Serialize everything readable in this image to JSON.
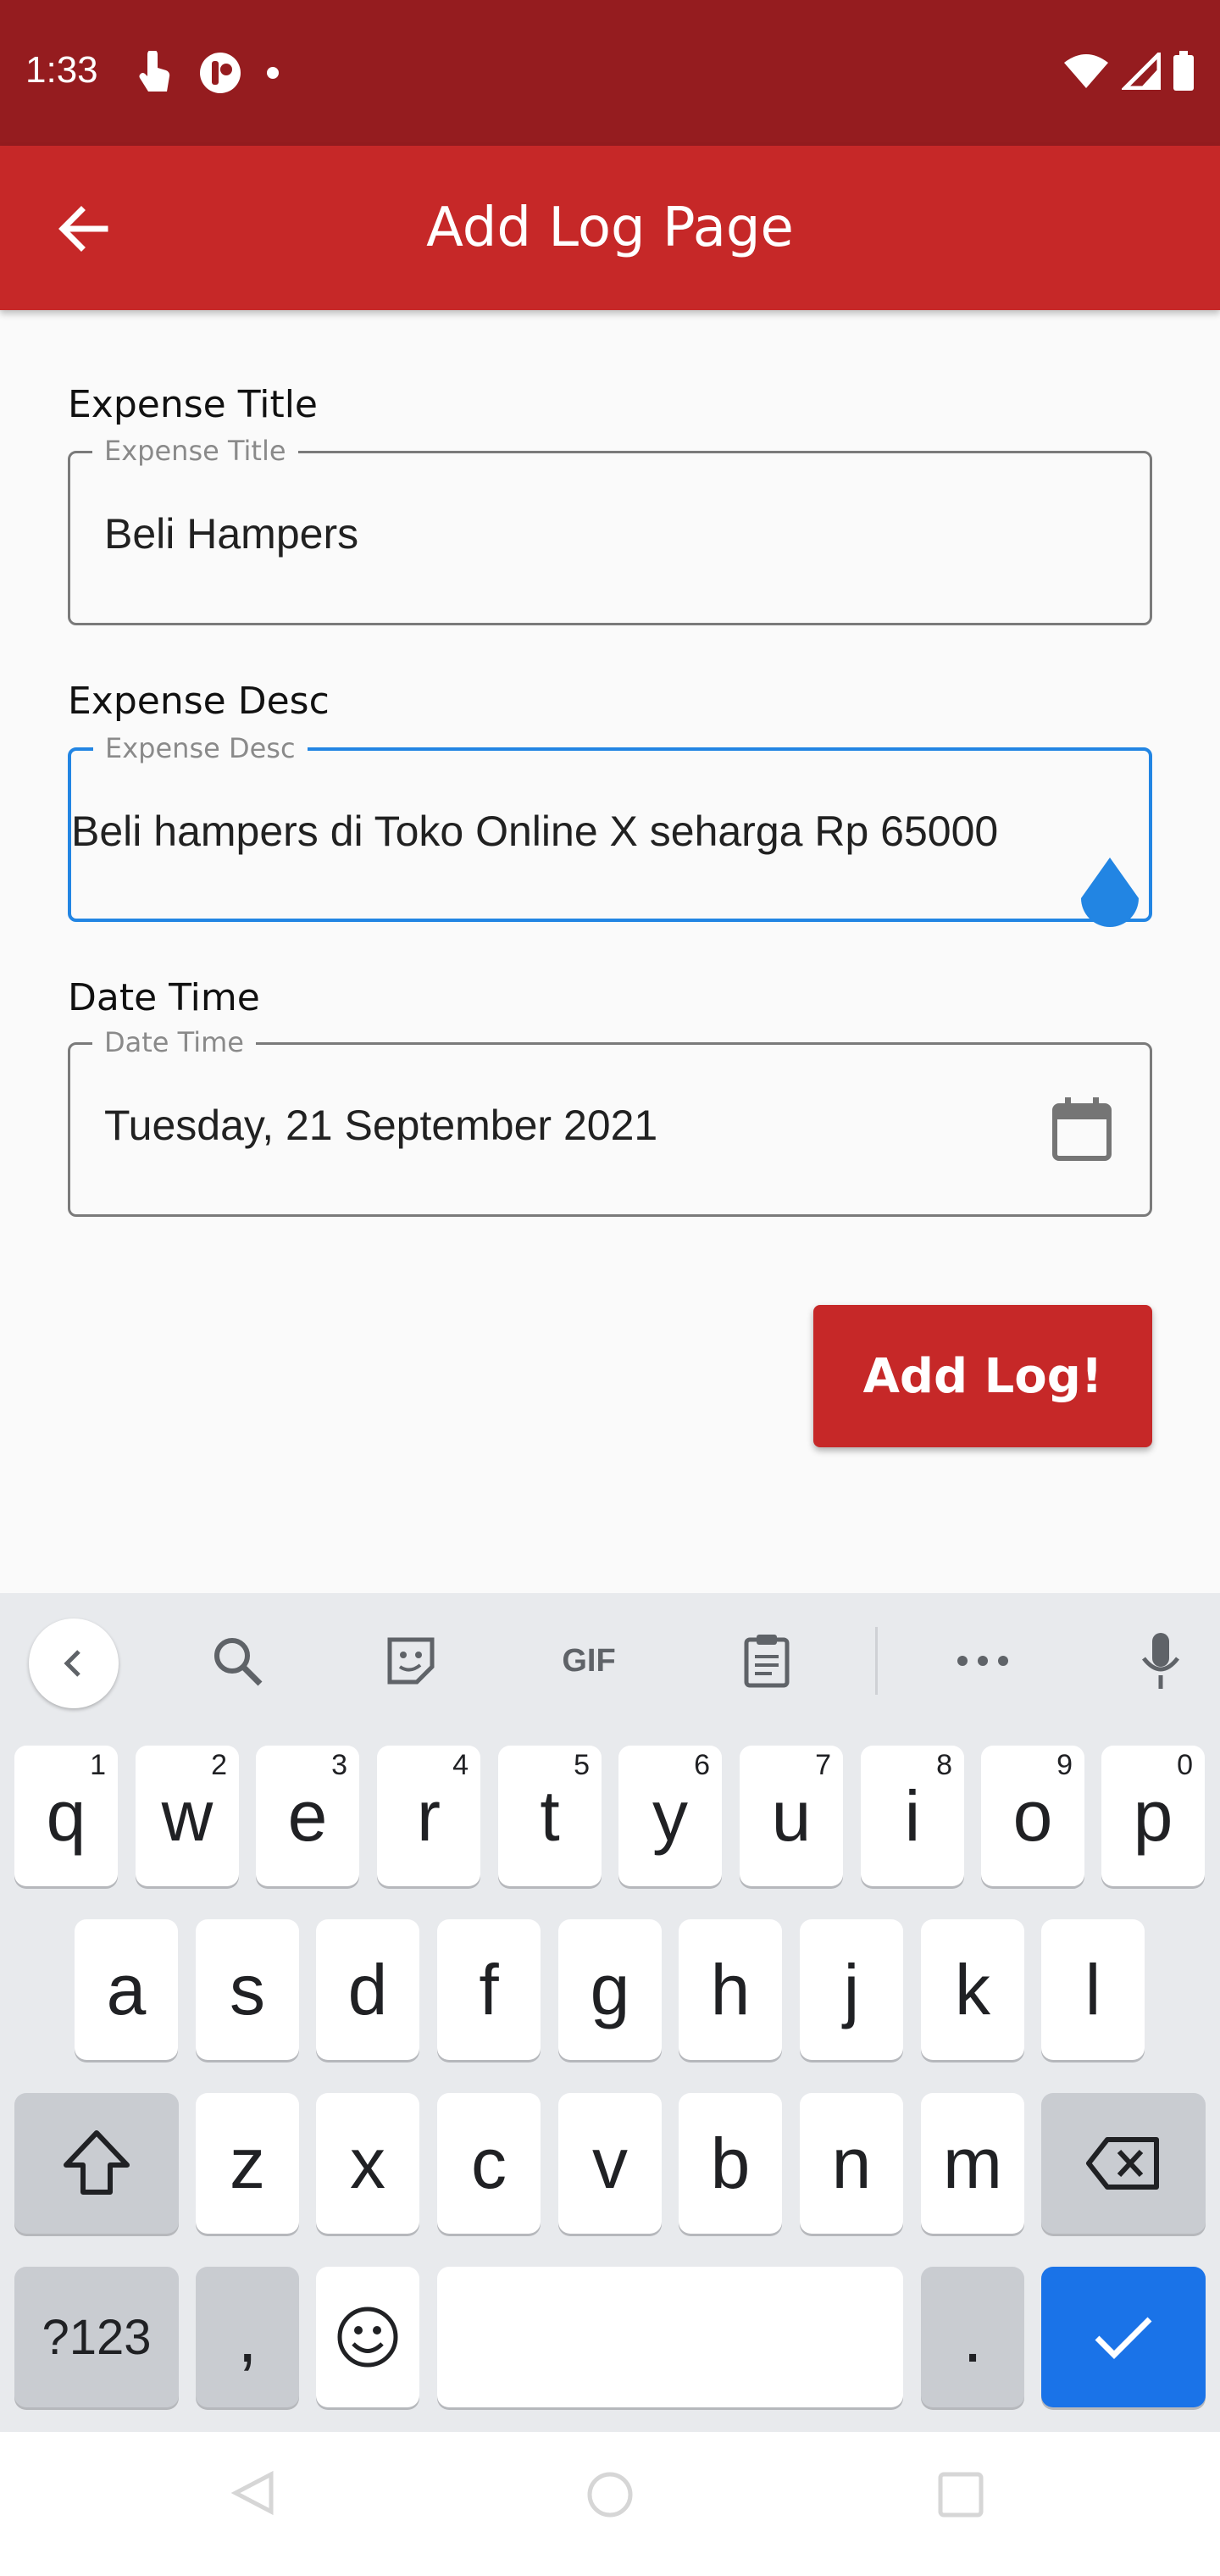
{
  "status_bar": {
    "time": "1:33",
    "left_icons": [
      "touch-icon",
      "app-badge-icon",
      "dot-icon"
    ],
    "right_icons": [
      "wifi-icon",
      "signal-icon",
      "battery-icon"
    ]
  },
  "app_bar": {
    "title": "Add Log Page",
    "back_icon": "arrow-back-icon",
    "color": "#c62828"
  },
  "form": {
    "title_field": {
      "label": "Expense Title",
      "legend": "Expense Title",
      "value": "Beli Hampers"
    },
    "desc_field": {
      "label": "Expense Desc",
      "legend": "Expense Desc",
      "value": "Beli hampers di Toko Online X seharga Rp 65000",
      "focused": true
    },
    "date_field": {
      "label": "Date Time",
      "legend": "Date Time",
      "value": "Tuesday, 21 September 2021",
      "icon": "calendar-icon"
    },
    "submit_label": "Add Log!"
  },
  "keyboard": {
    "toolbar": {
      "items": [
        "chevron-left-icon",
        "search-icon",
        "sticker-icon",
        "GIF",
        "clipboard-icon",
        "more-icon",
        "mic-icon"
      ],
      "gif_label": "GIF"
    },
    "row1": [
      {
        "k": "q",
        "s": "1"
      },
      {
        "k": "w",
        "s": "2"
      },
      {
        "k": "e",
        "s": "3"
      },
      {
        "k": "r",
        "s": "4"
      },
      {
        "k": "t",
        "s": "5"
      },
      {
        "k": "y",
        "s": "6"
      },
      {
        "k": "u",
        "s": "7"
      },
      {
        "k": "i",
        "s": "8"
      },
      {
        "k": "o",
        "s": "9"
      },
      {
        "k": "p",
        "s": "0"
      }
    ],
    "row2": [
      "a",
      "s",
      "d",
      "f",
      "g",
      "h",
      "j",
      "k",
      "l"
    ],
    "row3": [
      "z",
      "x",
      "c",
      "v",
      "b",
      "n",
      "m"
    ],
    "row4": {
      "symbols": "?123",
      "comma": ",",
      "period": "."
    },
    "enter_color": "#1a73e8"
  },
  "nav_bar": {
    "icons": [
      "nav-back-icon",
      "nav-home-icon",
      "nav-recents-icon"
    ]
  }
}
